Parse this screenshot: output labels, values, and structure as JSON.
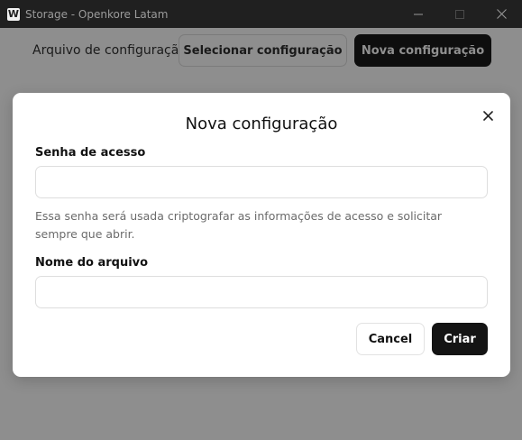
{
  "window": {
    "title": "Storage - Openkore Latam",
    "app_icon_letter": "W"
  },
  "toolbar": {
    "config_label": "Arquivo de configuração:",
    "select_config_label": "Selecionar configuração",
    "new_config_label": "Nova configuração"
  },
  "modal": {
    "title": "Nova configuração",
    "password_label": "Senha de acesso",
    "password_value": "",
    "password_help": "Essa senha será usada criptografar as informações de acesso e solicitar sempre que abrir.",
    "filename_label": "Nome do arquivo",
    "filename_value": "",
    "cancel_label": "Cancel",
    "create_label": "Criar"
  },
  "colors": {
    "overlay_bg": "#8e8e8e",
    "titlebar_bg": "#202020",
    "primary_button_bg": "#141414",
    "modal_bg": "#ffffff"
  },
  "icons": [
    "app-logo-icon",
    "minimize-icon",
    "maximize-icon",
    "window-close-icon",
    "modal-close-icon"
  ]
}
